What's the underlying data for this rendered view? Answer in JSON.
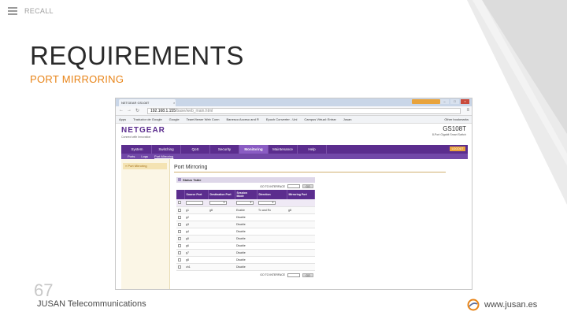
{
  "slide": {
    "top_label": "RECALL",
    "title": "REQUIREMENTS",
    "subtitle": "PORT MIRRORING",
    "page_number": "67",
    "footer_company": "JUSAN Telecommunications",
    "footer_url": "www.jusan.es",
    "colors": {
      "accent": "#e88418",
      "title": "#2a2a2a",
      "netgear_purple": "#5b2d8e"
    },
    "icons": {
      "menu": "hamburger-icon",
      "logo": "jusan-logo-icon"
    }
  },
  "browser": {
    "tab_title": "NETGEAR GS108T",
    "tab_close": "×",
    "badge_label": "",
    "address_host": "192.168.1.155",
    "address_path": "/base/web_main.html",
    "bookmarks": [
      "Apps",
      "Traductor de Google",
      "Google",
      "TeamViewer Web Conn",
      "Banesco Acceso and R",
      "Epoch Converter - Uni",
      "Campus Virtual: Entrar",
      "Jusan"
    ],
    "other_bookmarks": "Other bookmarks"
  },
  "netgear": {
    "brand": "NETGEAR",
    "tagline": "Connect with Innovation",
    "model": "GS108T",
    "model_desc": "8-Port Gigabit Smart Switch",
    "logout": "LOGOUT",
    "main_nav": [
      "System",
      "Switching",
      "QoS",
      "Security",
      "Monitoring",
      "Maintenance",
      "Help"
    ],
    "main_nav_active": "Monitoring",
    "sub_nav": [
      "Ports",
      "Logs",
      "Port Mirroring"
    ],
    "sub_nav_active": "Port Mirroring",
    "left_menu_item": "» Port Mirroring",
    "content_title": "Port Mirroring",
    "status_table_label": "Status Table",
    "goto_label": "GO TO INTERFACE",
    "go_button": "GO",
    "table": {
      "headers": [
        "",
        "Source Port",
        "Destination Port",
        "Session Mode",
        "Direction",
        "Mirroring Port"
      ],
      "rows": [
        {
          "source": "g1",
          "dest": "g8",
          "mode": "Enable",
          "direction": "Tx and Rx",
          "mirroring": "g8"
        },
        {
          "source": "g2",
          "dest": "",
          "mode": "Disable",
          "direction": "",
          "mirroring": ""
        },
        {
          "source": "g3",
          "dest": "",
          "mode": "Disable",
          "direction": "",
          "mirroring": ""
        },
        {
          "source": "g4",
          "dest": "",
          "mode": "Disable",
          "direction": "",
          "mirroring": ""
        },
        {
          "source": "g5",
          "dest": "",
          "mode": "Disable",
          "direction": "",
          "mirroring": ""
        },
        {
          "source": "g6",
          "dest": "",
          "mode": "Disable",
          "direction": "",
          "mirroring": ""
        },
        {
          "source": "g7",
          "dest": "",
          "mode": "Disable",
          "direction": "",
          "mirroring": ""
        },
        {
          "source": "g8",
          "dest": "",
          "mode": "Disable",
          "direction": "",
          "mirroring": ""
        },
        {
          "source": "ch1",
          "dest": "",
          "mode": "Disable",
          "direction": "",
          "mirroring": ""
        }
      ]
    }
  }
}
